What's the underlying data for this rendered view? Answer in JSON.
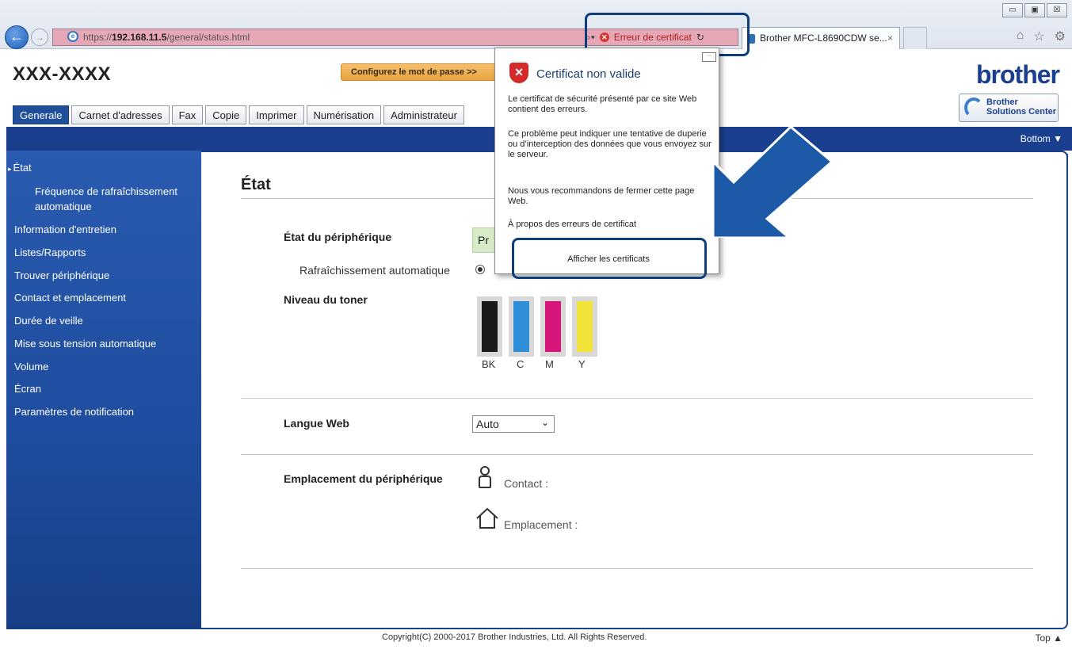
{
  "browser": {
    "url_host": "192.168.11.5",
    "url_prefix": "https://",
    "url_path": "/general/status.html",
    "cert_error_text": "Erreur de certificat",
    "tab_title": "Brother MFC-L8690CDW se...",
    "tab_close": "×",
    "win_min": "▭",
    "win_max": "▣",
    "win_close": "☒",
    "icons": [
      "home-icon",
      "favorites-icon",
      "settings-icon"
    ]
  },
  "page": {
    "title": "XXX-XXXX",
    "password_banner": "Configurez le mot de passe >>",
    "logo": "brother",
    "solutions_line1": "Brother",
    "solutions_line2": "Solutions Center",
    "bottom_link": "Bottom ▼",
    "top_link": "Top ▲",
    "footer": "Copyright(C) 2000-2017 Brother Industries, Ltd. All Rights Reserved."
  },
  "tabs": [
    {
      "label": "Generale",
      "active": true
    },
    {
      "label": "Carnet d'adresses"
    },
    {
      "label": "Fax"
    },
    {
      "label": "Copie"
    },
    {
      "label": "Imprimer"
    },
    {
      "label": "Numérisation"
    },
    {
      "label": "Administrateur"
    }
  ],
  "sidebar": {
    "items": [
      {
        "label": "État"
      },
      {
        "label": "Fréquence de rafraîchissement"
      },
      {
        "label": "automatique"
      },
      {
        "label": "Information d'entretien"
      },
      {
        "label": "Listes/Rapports"
      },
      {
        "label": "Trouver périphérique"
      },
      {
        "label": "Contact et emplacement"
      },
      {
        "label": "Durée de veille"
      },
      {
        "label": "Mise sous tension automatique"
      },
      {
        "label": "Volume"
      },
      {
        "label": "Écran"
      },
      {
        "label": "Paramètres de notification"
      }
    ]
  },
  "content": {
    "title": "État",
    "device_status_label": "État du périphérique",
    "device_status_value": "Pr",
    "auto_refresh_label": "Rafraîchissement automatique",
    "toner_label": "Niveau du toner",
    "toner": [
      {
        "label": "BK",
        "color": "#1a1a1a"
      },
      {
        "label": "C",
        "color": "#2f8ed8"
      },
      {
        "label": "M",
        "color": "#d6157a"
      },
      {
        "label": "Y",
        "color": "#f2e33a"
      }
    ],
    "web_lang_label": "Langue Web",
    "web_lang_value": "Auto",
    "location_label": "Emplacement du périphérique",
    "contact_label": "Contact :",
    "location_value_label": "Emplacement :"
  },
  "popup": {
    "title": "Certificat non valide",
    "text1": "Le certificat de sécurité présenté par ce site Web contient des erreurs.",
    "text2": "Ce problème peut indiquer une tentative de duperie ou d’interception des données que vous envoyez sur le serveur.",
    "text3": "Nous vous recommandons de fermer cette page Web.",
    "link": "À propos des erreurs de certificat",
    "button": "Afficher les certificats"
  },
  "colors": {
    "accent": "#1a3f8e",
    "highlight": "#0f3d7a",
    "address_error": "#e6a7b6"
  }
}
